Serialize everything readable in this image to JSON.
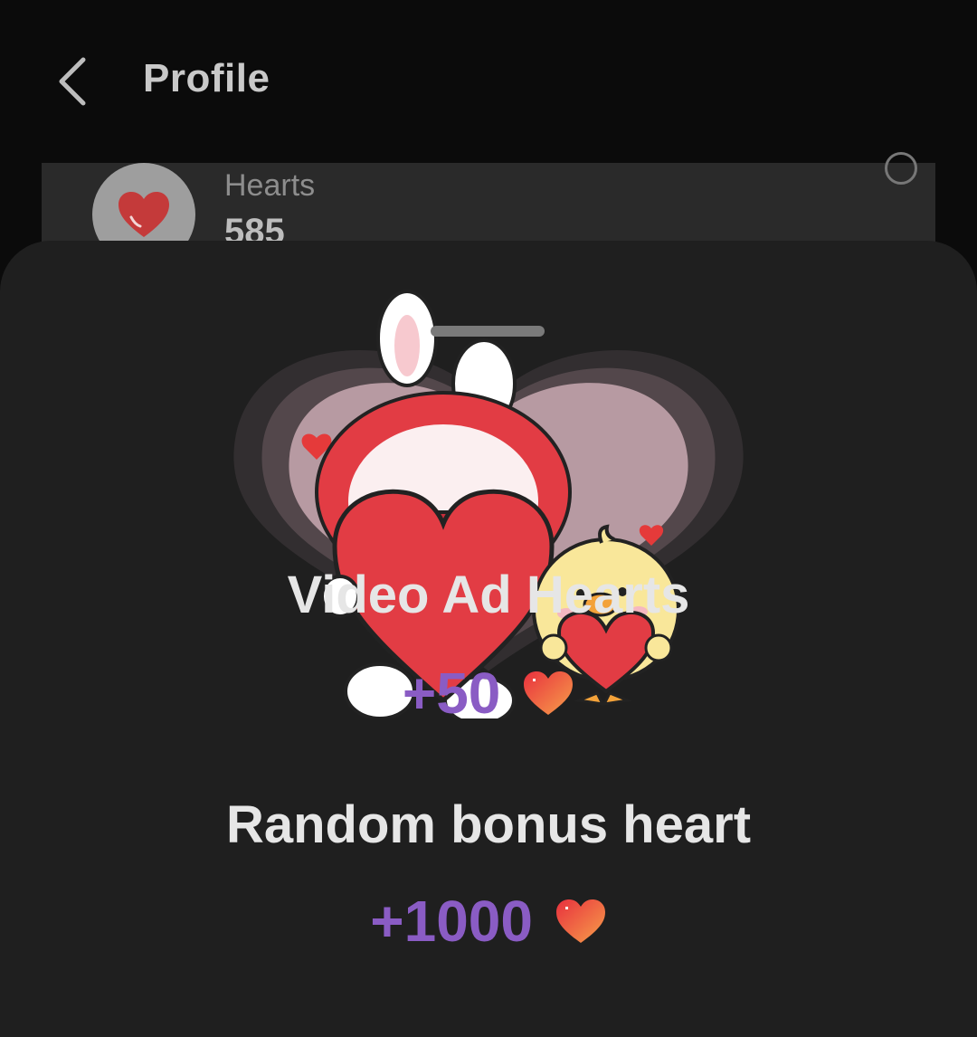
{
  "header": {
    "title": "Profile"
  },
  "hearts_card": {
    "label": "Hearts",
    "count": "585"
  },
  "rewards": [
    {
      "title": "Video Ad Hearts",
      "amount": "+50"
    },
    {
      "title": "Random bonus heart",
      "amount": "+1000"
    }
  ],
  "colors": {
    "accent_purple": "#8a5cc4",
    "sheet_bg": "#1f1f1f",
    "heart_red": "#e53a3a",
    "heart_orange": "#f37a3d"
  },
  "icons": [
    "back-chevron-icon",
    "heart-icon",
    "info-icon"
  ]
}
